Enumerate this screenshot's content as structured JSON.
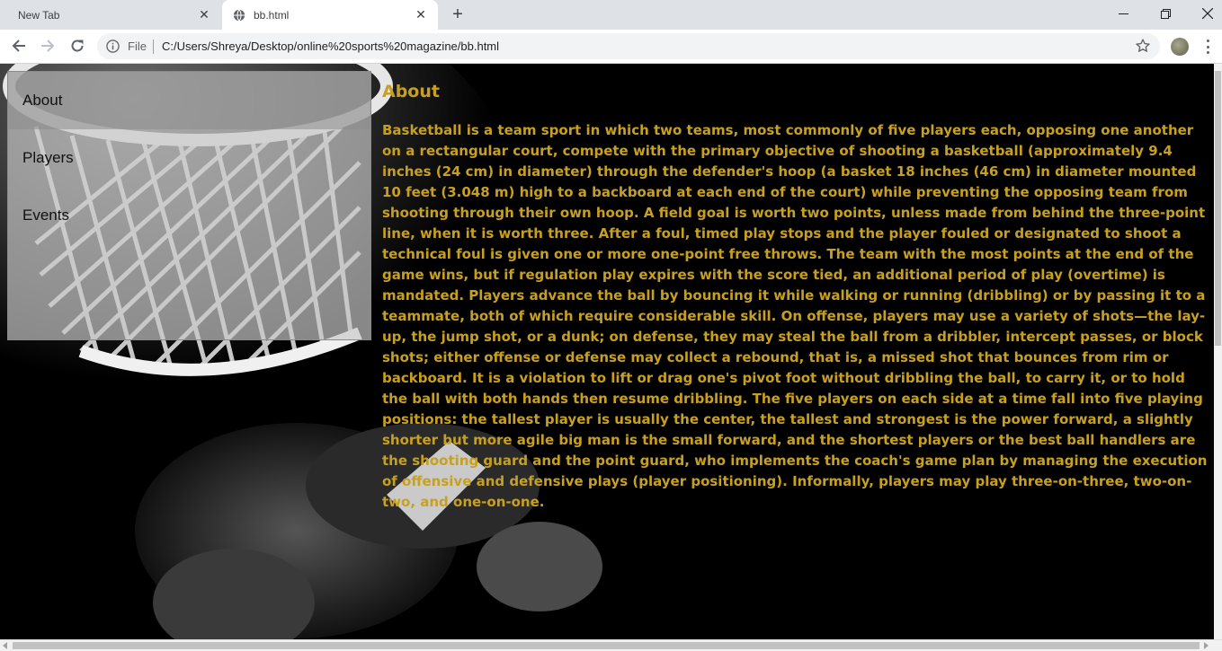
{
  "browser": {
    "tabs": [
      {
        "title": "New Tab",
        "active": false
      },
      {
        "title": "bb.html",
        "active": true
      }
    ],
    "address": {
      "scheme_label": "File",
      "url": "C:/Users/Shreya/Desktop/online%20sports%20magazine/bb.html"
    },
    "icons": {
      "new_tab": "plus-icon",
      "minimize": "minimize-icon",
      "restore": "restore-icon",
      "close_window": "close-icon",
      "back": "arrow-left-icon",
      "forward": "arrow-right-icon",
      "reload": "reload-icon",
      "info": "info-icon",
      "bookmark": "star-icon",
      "profile": "avatar",
      "menu": "kebab-icon"
    }
  },
  "sidebar": {
    "items": [
      {
        "label": "About",
        "active": true
      },
      {
        "label": "Players",
        "active": false
      },
      {
        "label": "Events",
        "active": false
      }
    ]
  },
  "main": {
    "heading": "About",
    "body": "Basketball is a team sport in which two teams, most commonly of five players each, opposing one another on a rectangular court, compete with the primary objective of shooting a basketball (approximately 9.4 inches (24 cm) in diameter) through the defender's hoop (a basket 18 inches (46 cm) in diameter mounted 10 feet (3.048 m) high to a backboard at each end of the court) while preventing the opposing team from shooting through their own hoop. A field goal is worth two points, unless made from behind the three-point line, when it is worth three. After a foul, timed play stops and the player fouled or designated to shoot a technical foul is given one or more one-point free throws. The team with the most points at the end of the game wins, but if regulation play expires with the score tied, an additional period of play (overtime) is mandated. Players advance the ball by bouncing it while walking or running (dribbling) or by passing it to a teammate, both of which require considerable skill. On offense, players may use a variety of shots—the lay-up, the jump shot, or a dunk; on defense, they may steal the ball from a dribbler, intercept passes, or block shots; either offense or defense may collect a rebound, that is, a missed shot that bounces from rim or backboard. It is a violation to lift or drag one's pivot foot without dribbling the ball, to carry it, or to hold the ball with both hands then resume dribbling. The five players on each side at a time fall into five playing positions: the tallest player is usually the center, the tallest and strongest is the power forward, a slightly shorter but more agile big man is the small forward, and the shortest players or the best ball handlers are the shooting guard and the point guard, who implements the coach's game plan by managing the execution of offensive and defensive plays (player positioning). Informally, players may play three-on-three, two-on-two, and one-on-one."
  },
  "colors": {
    "page_background": "#000000",
    "text_accent": "#c8a020",
    "sidebar_background": "#c8c8c8",
    "sidebar_active": "#8c8c8c"
  }
}
